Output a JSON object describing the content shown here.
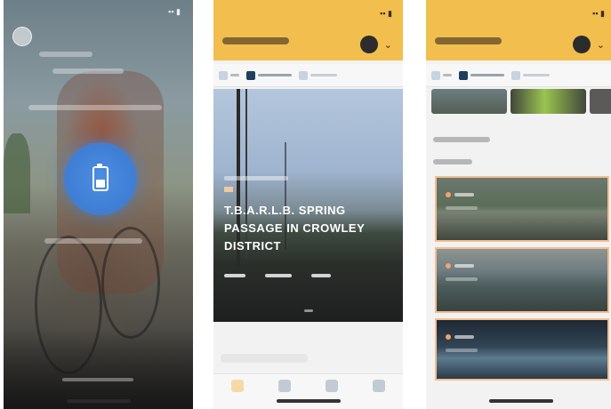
{
  "screens": {
    "featured": {
      "story": {
        "title": "T.B.A.R.L.B. SPRING PASSAGE IN CROWLEY DISTRICT"
      }
    }
  },
  "colors": {
    "header_yellow": "#f2be4e",
    "cta_blue": "#3f7fd6",
    "card_border": "#f4bd8f",
    "home_indicator": "#333333"
  }
}
